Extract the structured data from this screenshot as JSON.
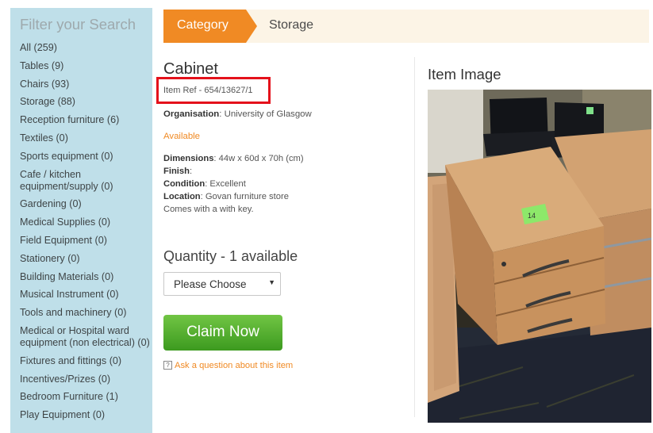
{
  "sidebar": {
    "title": "Filter your Search",
    "items": [
      "All (259)",
      "Tables (9)",
      "Chairs (93)",
      "Storage (88)",
      "Reception furniture (6)",
      "Textiles (0)",
      "Sports equipment (0)",
      "Cafe / kitchen equipment/supply (0)",
      "Gardening (0)",
      "Medical Supplies (0)",
      "Field Equipment (0)",
      "Stationery (0)",
      "Building Materials (0)",
      "Musical Instrument (0)",
      "Tools and machinery (0)",
      "Medical or Hospital ward equipment (non electrical) (0)",
      "Fixtures and fittings (0)",
      "Incentives/Prizes (0)",
      "Bedroom Furniture (1)",
      "Play Equipment (0)"
    ]
  },
  "breadcrumb": {
    "category": "Category",
    "current": "Storage"
  },
  "item": {
    "title": "Cabinet",
    "ref": "Item Ref - 654/13627/1",
    "organisation_label": "Organisation",
    "organisation": ": University of Glasgow",
    "status": "Available",
    "dimensions_label": "Dimensions",
    "dimensions": ": 44w x 60d x 70h (cm)",
    "finish_label": "Finish",
    "finish": ":",
    "condition_label": "Condition",
    "condition": ": Excellent",
    "location_label": "Location",
    "location": ": Govan furniture store",
    "note": "Comes with a with key."
  },
  "quantity": {
    "title": "Quantity - 1 available",
    "select_value": "Please Choose"
  },
  "claim_label": "Claim Now",
  "ask_icon": "?",
  "ask_label": "Ask a question about this item",
  "image_panel": {
    "title": "Item Image",
    "sticker_text": "14"
  },
  "colors": {
    "accent": "#f08a24",
    "sidebar_bg": "#bfdfe9",
    "claim_green": "#4caf2a",
    "highlight_red": "#e4111b"
  }
}
